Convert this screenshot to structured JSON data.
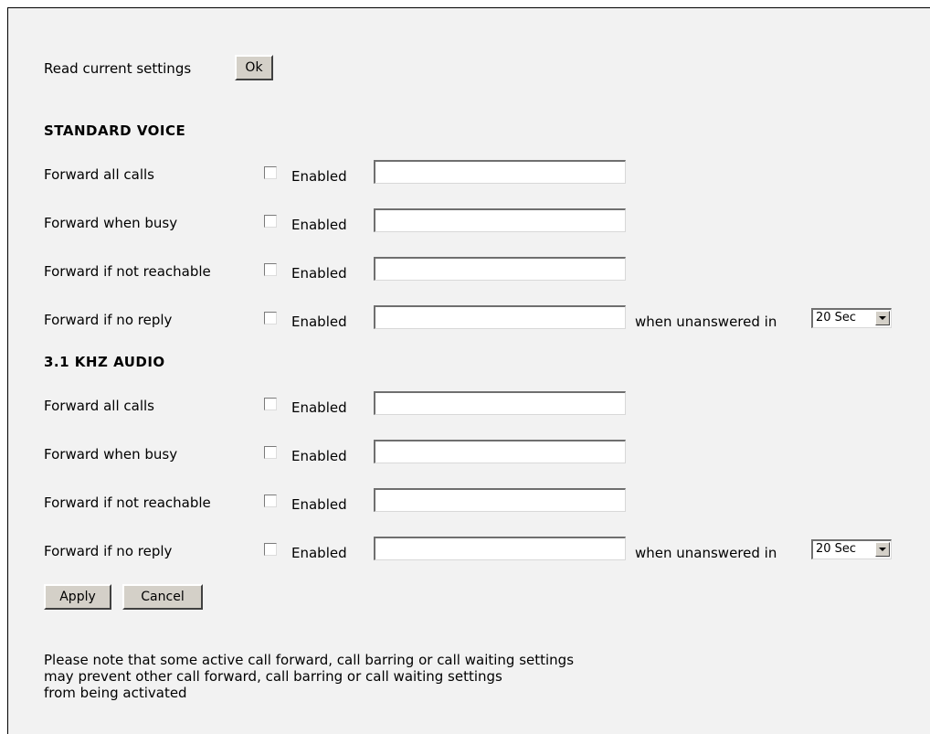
{
  "read_settings": {
    "label": "Read current settings",
    "button": "Ok"
  },
  "sections": [
    {
      "title": "STANDARD VOICE",
      "rows": [
        {
          "label": "Forward all calls",
          "checkbox_label": "Enabled",
          "checked": false,
          "value": ""
        },
        {
          "label": "Forward when busy",
          "checkbox_label": "Enabled",
          "checked": false,
          "value": ""
        },
        {
          "label": "Forward if not reachable",
          "checkbox_label": "Enabled",
          "checked": false,
          "value": ""
        },
        {
          "label": "Forward if no reply",
          "checkbox_label": "Enabled",
          "checked": false,
          "value": "",
          "unanswered_label": "when unanswered in",
          "unanswered_value": "20 Sec"
        }
      ]
    },
    {
      "title": "3.1 KHZ AUDIO",
      "rows": [
        {
          "label": "Forward all calls",
          "checkbox_label": "Enabled",
          "checked": false,
          "value": ""
        },
        {
          "label": "Forward when busy",
          "checkbox_label": "Enabled",
          "checked": false,
          "value": ""
        },
        {
          "label": "Forward if not reachable",
          "checkbox_label": "Enabled",
          "checked": false,
          "value": ""
        },
        {
          "label": "Forward if no reply",
          "checkbox_label": "Enabled",
          "checked": false,
          "value": "",
          "unanswered_label": "when unanswered in",
          "unanswered_value": "20 Sec"
        }
      ]
    }
  ],
  "actions": {
    "apply": "Apply",
    "cancel": "Cancel"
  },
  "note": [
    "Please note that some active call forward, call barring or call waiting settings",
    "may prevent other call forward, call barring or call waiting settings",
    "from being activated"
  ]
}
